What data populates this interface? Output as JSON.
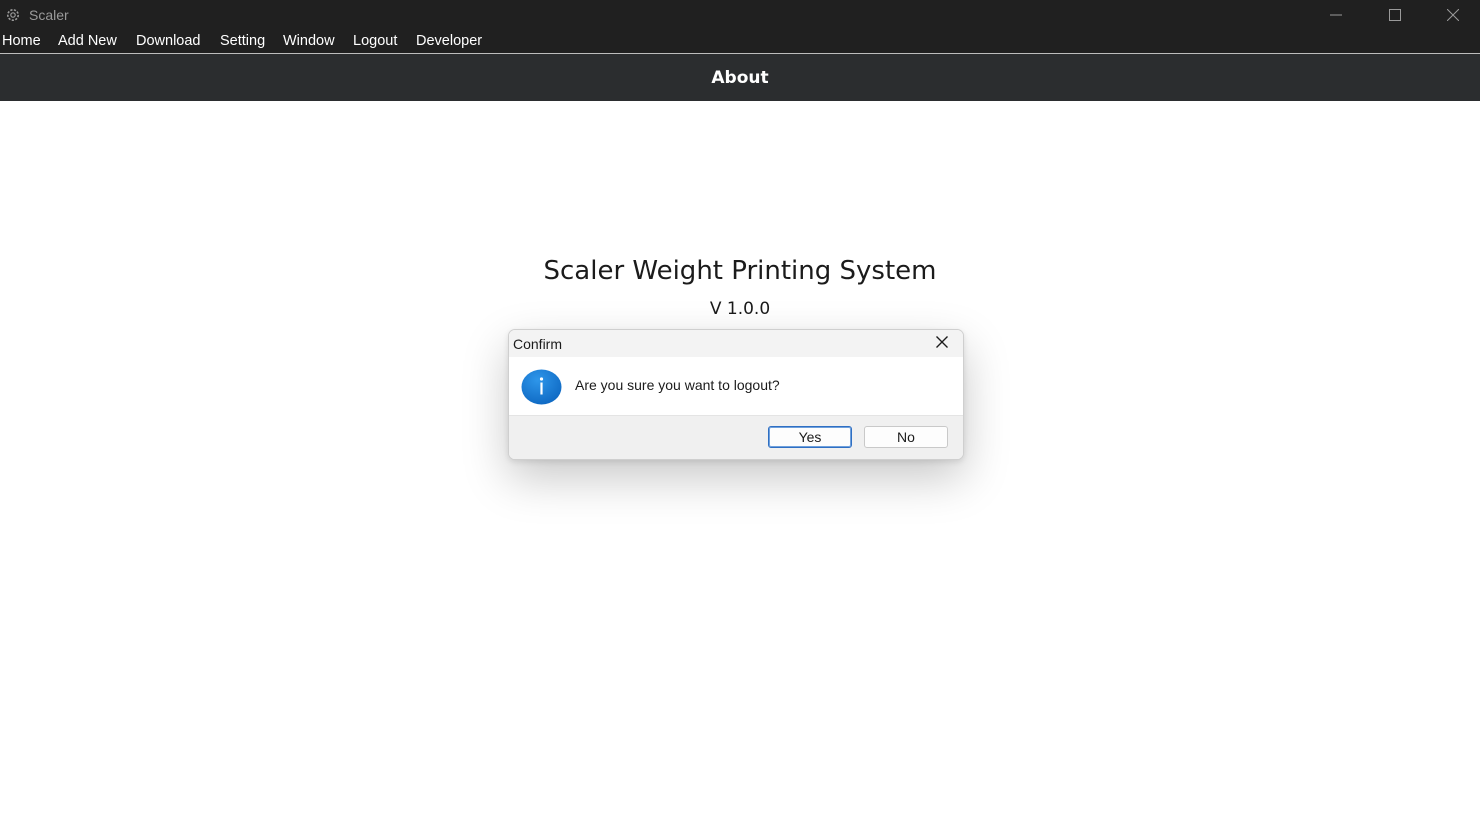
{
  "window": {
    "title": "Scaler",
    "icon": "gear-icon",
    "controls": [
      "minimize-icon",
      "maximize-icon",
      "close-icon"
    ]
  },
  "menu": {
    "items": [
      "Home",
      "Add New",
      "Download",
      "Setting",
      "Window",
      "Logout",
      "Developer"
    ]
  },
  "header": {
    "title": "About"
  },
  "about": {
    "app_name": "Scaler Weight Printing System",
    "version": "V 1.0.0"
  },
  "dialog": {
    "title": "Confirm",
    "icon": "info-icon",
    "message": "Are you sure you want to logout?",
    "yes_label": "Yes",
    "no_label": "No"
  },
  "colors": {
    "titlebar": "#202020",
    "header": "#2b2d2f",
    "info_icon": "#1479d4",
    "primary_button_border": "#2f6fc3"
  }
}
